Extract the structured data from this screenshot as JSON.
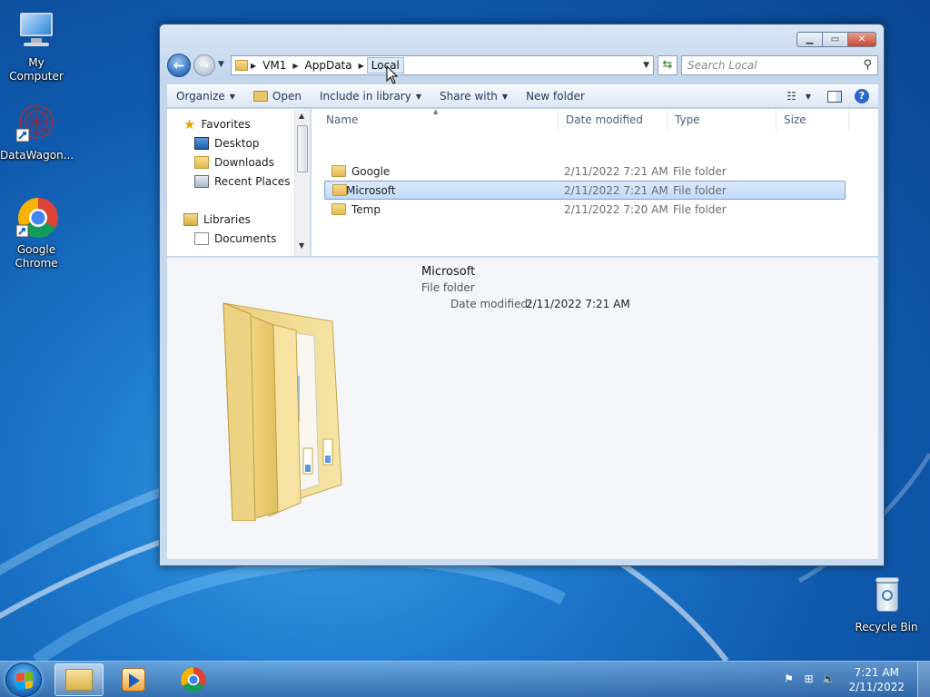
{
  "desktop": {
    "icons": [
      {
        "label": "My Computer"
      },
      {
        "label": "DataWagon..."
      },
      {
        "label": "Google Chrome"
      },
      {
        "label": "Recycle Bin"
      }
    ]
  },
  "window": {
    "address": {
      "crumbs": [
        "VM1",
        "AppData",
        "Local"
      ]
    },
    "search_placeholder": "Search Local",
    "toolbar": {
      "organize": "Organize",
      "open": "Open",
      "include_in_library": "Include in library",
      "share_with": "Share with",
      "new_folder": "New folder"
    },
    "nav_pane": {
      "favorites": "Favorites",
      "desktop": "Desktop",
      "downloads": "Downloads",
      "recent_places": "Recent Places",
      "libraries": "Libraries",
      "documents": "Documents"
    },
    "columns": {
      "name": "Name",
      "date_modified": "Date modified",
      "type": "Type",
      "size": "Size"
    },
    "files": [
      {
        "name": "Google",
        "date": "2/11/2022 7:21 AM",
        "type": "File folder"
      },
      {
        "name": "Microsoft",
        "date": "2/11/2022 7:21 AM",
        "type": "File folder"
      },
      {
        "name": "Temp",
        "date": "2/11/2022 7:20 AM",
        "type": "File folder"
      }
    ],
    "details": {
      "name": "Microsoft",
      "type": "File folder",
      "date_label": "Date modified:",
      "date_value": "2/11/2022 7:21 AM"
    }
  },
  "taskbar": {
    "clock_time": "7:21 AM",
    "clock_date": "2/11/2022"
  },
  "colors": {
    "accent": "#2a67c9",
    "selection": "#c1dbfa",
    "folder": "#e2b850"
  }
}
